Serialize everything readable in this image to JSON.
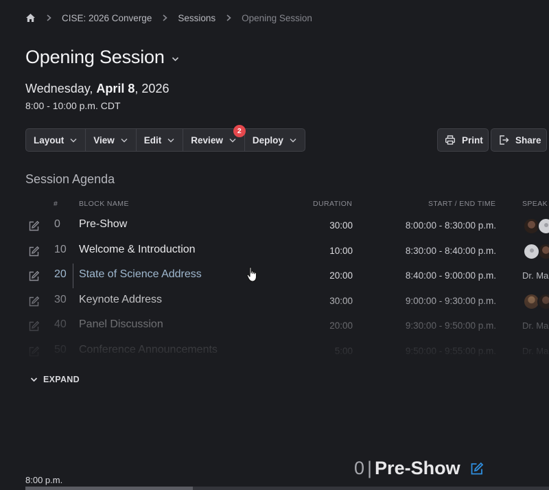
{
  "breadcrumb": {
    "items": [
      "CISE: 2026 Converge",
      "Sessions",
      "Opening Session"
    ]
  },
  "page": {
    "title": "Opening Session",
    "date_weekday": "Wednesday, ",
    "date_month_day": "April 8",
    "date_year": ", 2026",
    "time_range": "8:00 - 10:00 p.m. CDT"
  },
  "toolbar": {
    "buttons": [
      "Layout",
      "View",
      "Edit",
      "Review",
      "Deploy"
    ],
    "review_badge": "2",
    "print_label": "Print",
    "share_label": "Share"
  },
  "agenda": {
    "title": "Session Agenda",
    "headers": {
      "num": "#",
      "name": "BLOCK NAME",
      "duration": "DURATION",
      "time": "START / END TIME",
      "speakers": "SPEAK"
    },
    "rows": [
      {
        "num": "0",
        "name": "Pre-Show",
        "duration": "30:00",
        "time": "8:00:00 - 8:30:00 p.m.",
        "speakers": ""
      },
      {
        "num": "10",
        "name": "Welcome & Introduction",
        "duration": "10:00",
        "time": "8:30:00 - 8:40:00 p.m.",
        "speakers": ""
      },
      {
        "num": "20",
        "name": "State of Science Address",
        "duration": "20:00",
        "time": "8:40:00 - 9:00:00 p.m.",
        "speakers": "Dr. Ma"
      },
      {
        "num": "30",
        "name": "Keynote Address",
        "duration": "30:00",
        "time": "9:00:00 - 9:30:00 p.m.",
        "speakers": ""
      },
      {
        "num": "40",
        "name": "Panel Discussion",
        "duration": "20:00",
        "time": "9:30:00 - 9:50:00 p.m.",
        "speakers": "Dr. Ma"
      },
      {
        "num": "50",
        "name": "Conference Announcements",
        "duration": "5:00",
        "time": "9:50:00 - 9:55:00 p.m.",
        "speakers": "Dr. Ma"
      }
    ],
    "expand_label": "EXPAND"
  },
  "detail": {
    "time_marker": "8:00 p.m.",
    "block_num": "0",
    "block_sep": "|",
    "block_name": "Pre-Show"
  },
  "progress": {
    "fraction": 0.32
  },
  "colors": {
    "background": "#1b1c20",
    "accent_blue": "#2f8fe0",
    "badge_red": "#e5484d"
  },
  "icons": [
    "home-icon",
    "chevron-right-icon",
    "chevron-down-icon",
    "printer-icon",
    "share-icon",
    "edit-icon",
    "hand-cursor-icon"
  ]
}
